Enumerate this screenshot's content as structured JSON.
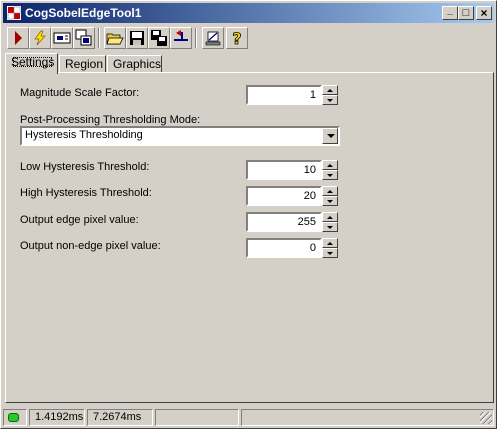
{
  "window": {
    "title": "CogSobelEdgeTool1",
    "caption_buttons": {
      "minimize": "_",
      "maximize": "□",
      "close": "×"
    }
  },
  "toolbar": {
    "buttons": [
      "run-icon",
      "electric-run-icon",
      "key-image-icon",
      "show-image-icon",
      "open-folder-icon",
      "save-icon",
      "save-as-icon",
      "reset-icon",
      "tool-icon",
      "help-icon"
    ]
  },
  "tabs": [
    {
      "label": "Settings",
      "active": true
    },
    {
      "label": "Region",
      "active": false
    },
    {
      "label": "Graphics",
      "active": false
    }
  ],
  "settings": {
    "magnitude_scale_factor": {
      "label": "Magnitude Scale Factor:",
      "value": "1"
    },
    "thresholding_mode": {
      "label": "Post-Processing Thresholding Mode:",
      "value": "Hysteresis Thresholding"
    },
    "low_threshold": {
      "label": "Low Hysteresis Threshold:",
      "value": "10"
    },
    "high_threshold": {
      "label": "High Hysteresis Threshold:",
      "value": "20"
    },
    "edge_value": {
      "label": "Output edge pixel value:",
      "value": "255"
    },
    "nonedge_value": {
      "label": "Output non-edge pixel value:",
      "value": "0"
    }
  },
  "status": {
    "led_color": "#28c828",
    "time1": "1.4192ms",
    "time2": "7.2674ms"
  },
  "colors": {
    "title_start": "#0a246a",
    "title_end": "#a6caf0",
    "face": "#d4d0c8"
  }
}
